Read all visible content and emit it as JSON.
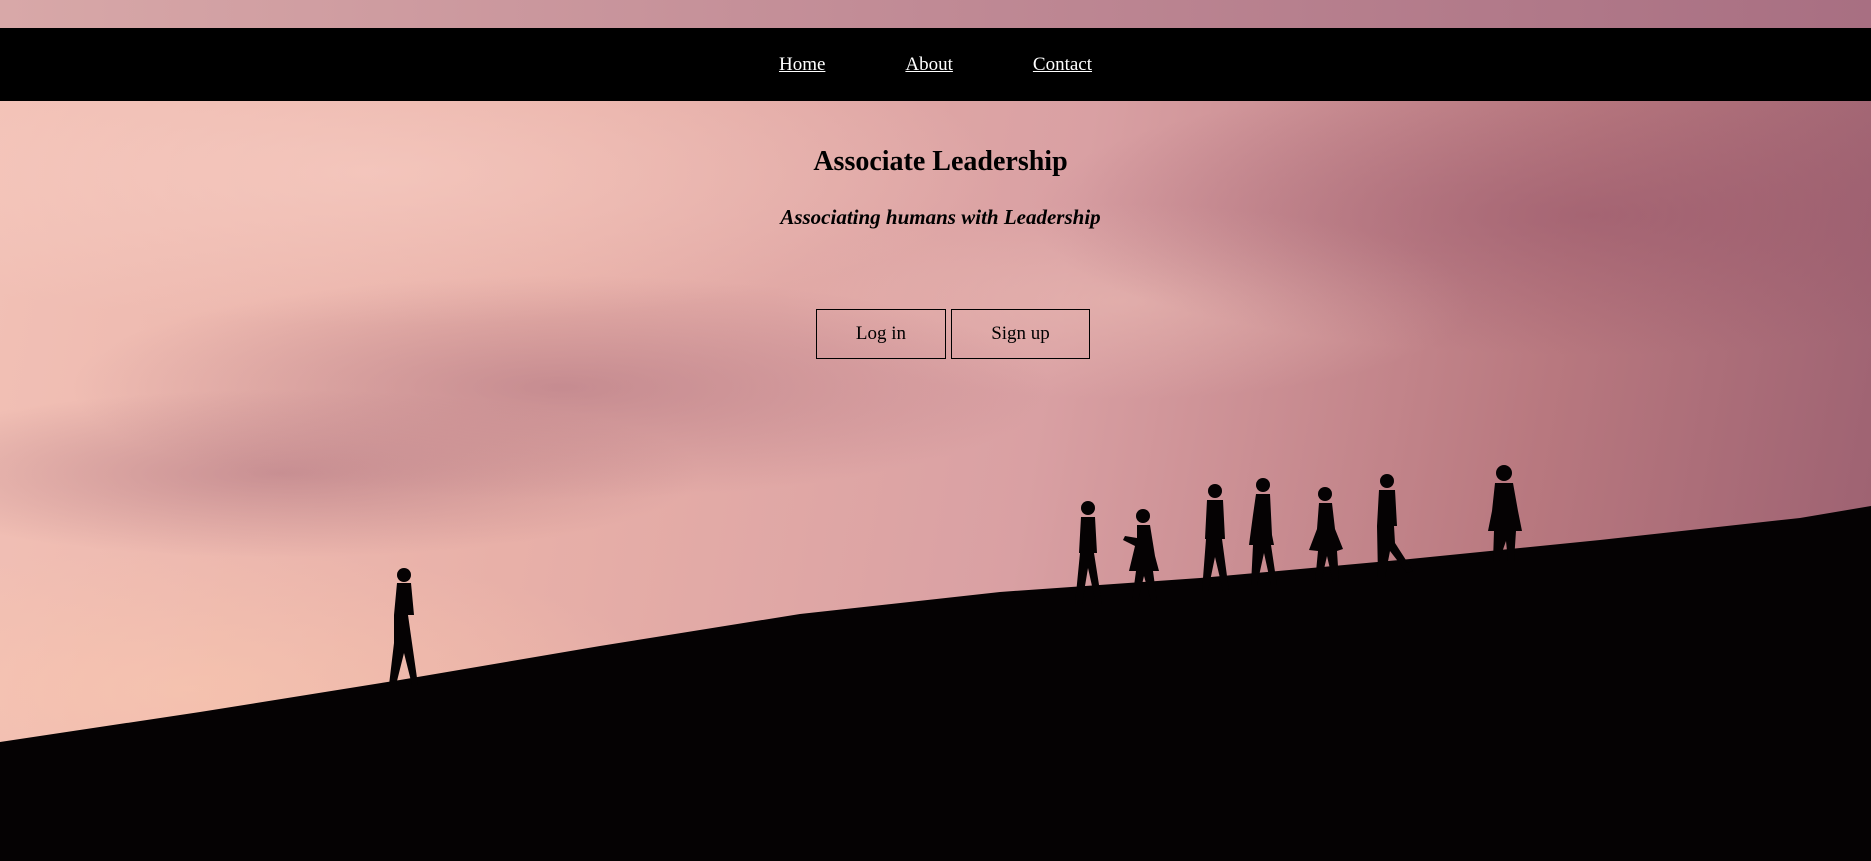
{
  "nav": {
    "items": [
      {
        "label": "Home"
      },
      {
        "label": "About"
      },
      {
        "label": "Contact"
      }
    ]
  },
  "hero": {
    "title": "Associate Leadership",
    "subtitle": "Associating humans with Leadership"
  },
  "buttons": {
    "login_label": "Log in",
    "signup_label": "Sign up"
  }
}
